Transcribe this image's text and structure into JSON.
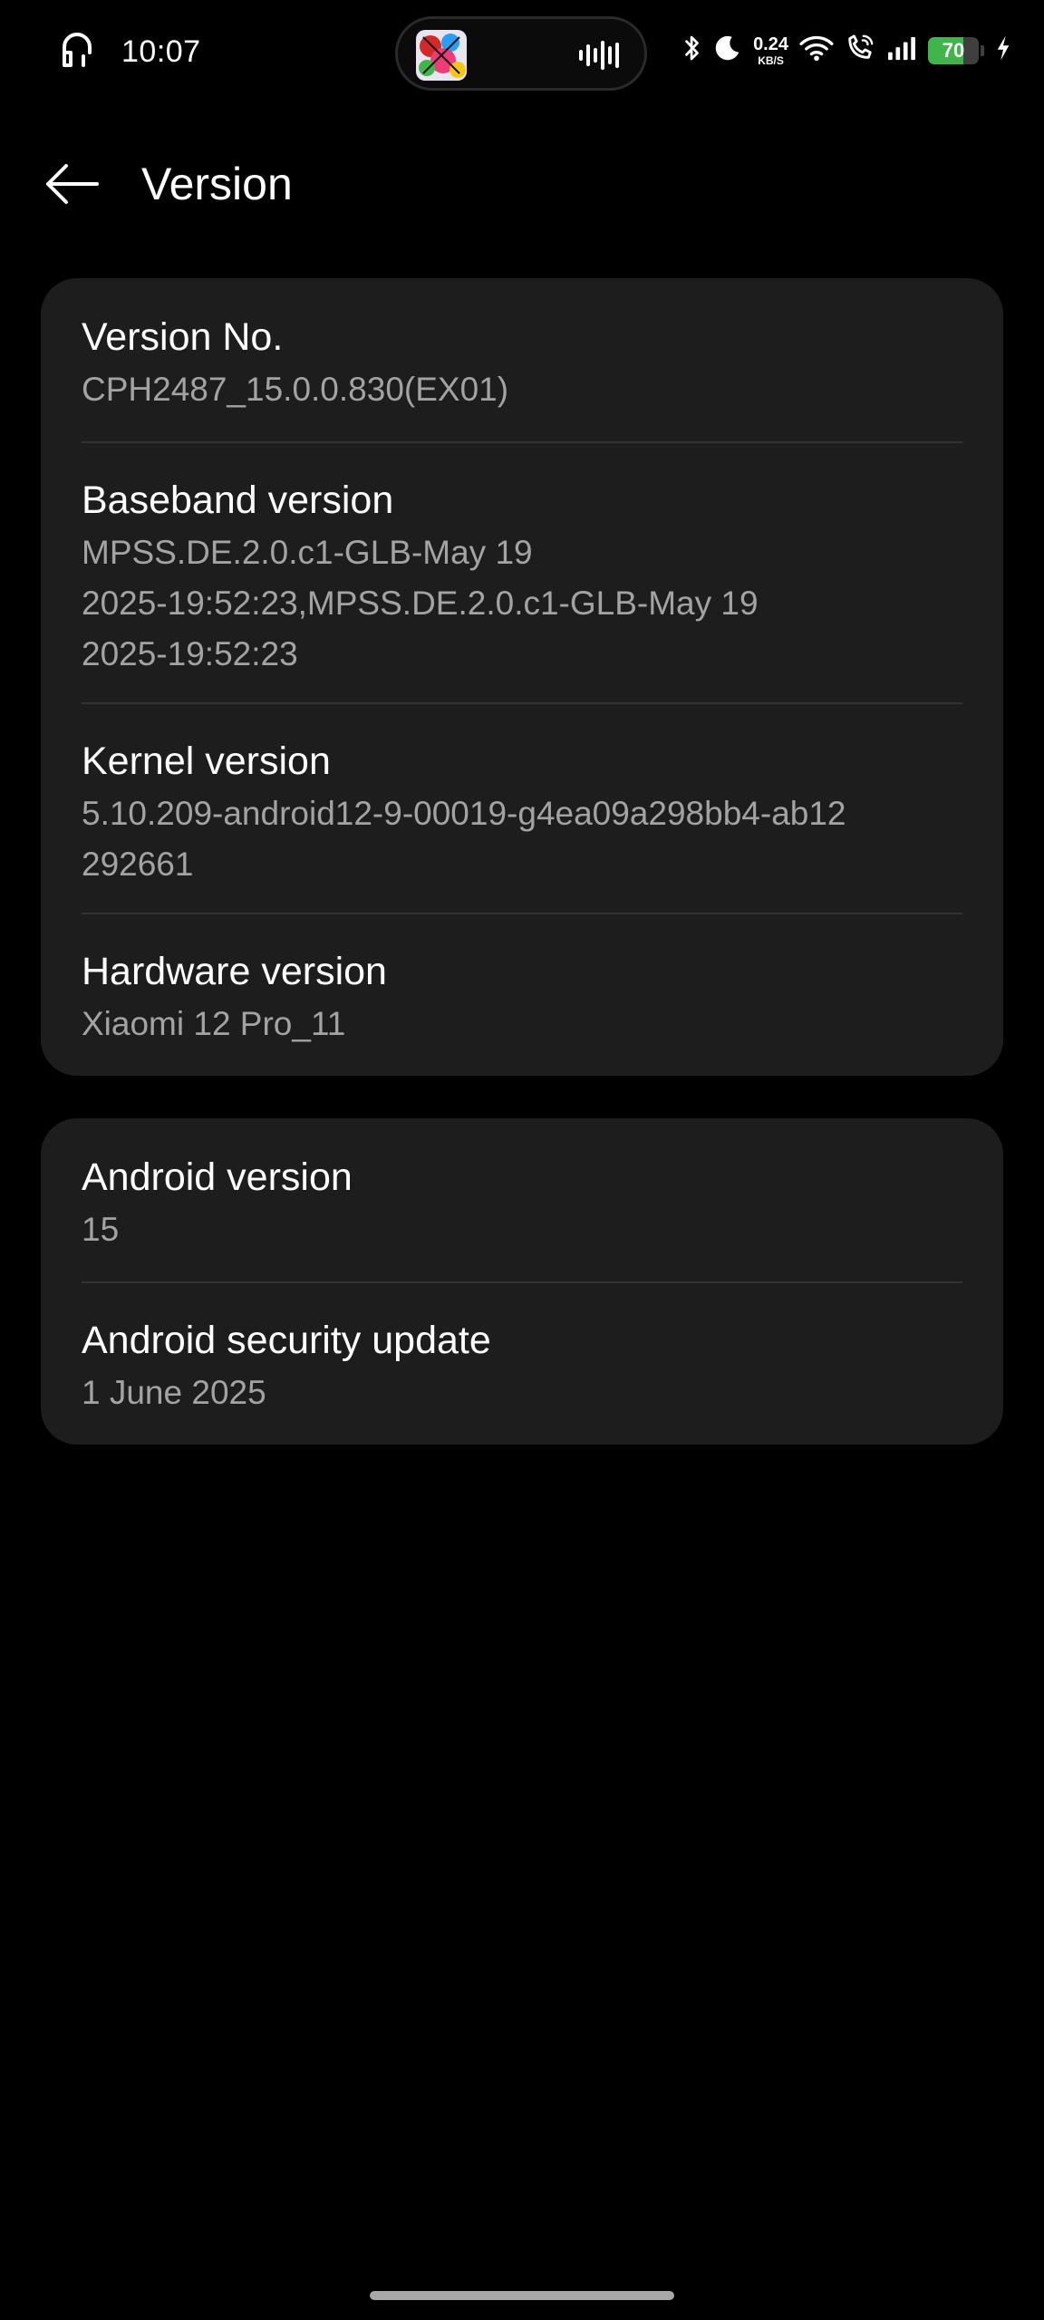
{
  "status_bar": {
    "time": "10:07",
    "net_speed_value": "0.24",
    "net_speed_unit": "KB/S",
    "battery_level": "70",
    "battery_fraction": 0.7,
    "icons": [
      "headphones-icon",
      "now-playing-artwork",
      "audio-wave-icon",
      "bluetooth-icon",
      "do-not-disturb-moon-icon",
      "wifi-icon",
      "wifi-calling-icon",
      "cellular-signal-icon",
      "battery-icon",
      "charging-bolt-icon"
    ],
    "battery_color": "#3fb54c"
  },
  "header": {
    "title": "Version",
    "back_icon": "arrow-left-icon"
  },
  "groups": [
    {
      "items": [
        {
          "title": "Version No.",
          "value": "CPH2487_15.0.0.830(EX01)"
        },
        {
          "title": "Baseband version",
          "value": "MPSS.DE.2.0.c1-GLB-May 19\n2025-19:52:23,MPSS.DE.2.0.c1-GLB-May 19\n2025-19:52:23"
        },
        {
          "title": "Kernel version",
          "value": "5.10.209-android12-9-00019-g4ea09a298bb4-ab12\n292661"
        },
        {
          "title": "Hardware version",
          "value": "Xiaomi 12 Pro_11"
        }
      ]
    },
    {
      "items": [
        {
          "title": "Android version",
          "value": "15"
        },
        {
          "title": "Android security update",
          "value": "1 June 2025"
        }
      ]
    }
  ],
  "colors": {
    "background": "#000000",
    "card": "#1d1d1d",
    "title_text": "#ffffff",
    "value_text": "#a3a3a3",
    "divider": "#333333"
  }
}
